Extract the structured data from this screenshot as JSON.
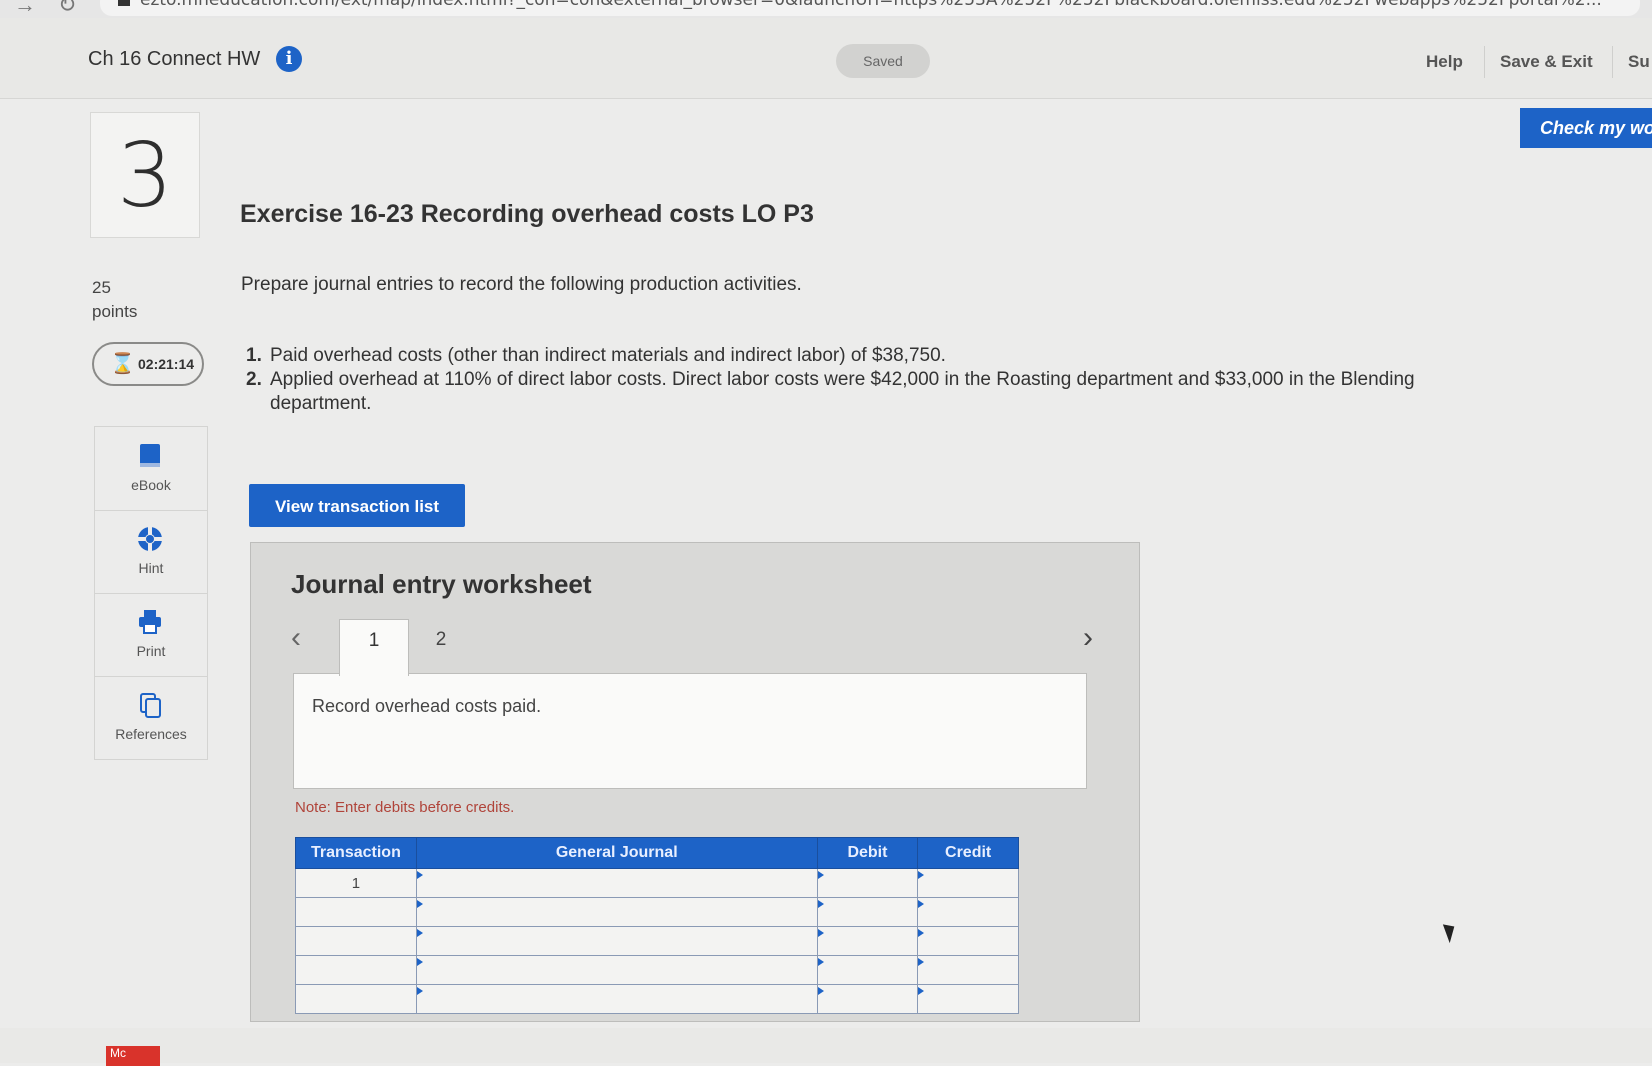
{
  "browser": {
    "url": "ezto.mheducation.com/ext/map/index.html?_con=con&external_browser=0&launchUrl=https%253A%252F%252Fblackboard.olemiss.edu%252Fwebapps%252Fportal%2..."
  },
  "header": {
    "assignment_title": "Ch 16 Connect HW",
    "info_icon": "i",
    "saved_label": "Saved",
    "help_label": "Help",
    "save_exit_label": "Save & Exit",
    "submit_label": "Su"
  },
  "question": {
    "number": "3",
    "points_value": "25",
    "points_label": "points",
    "timer": "02:21:14",
    "title": "Exercise 16-23 Recording overhead costs LO P3",
    "instruction": "Prepare journal entries to record the following production activities.",
    "tasks": [
      {
        "num": "1.",
        "text": "Paid overhead costs (other than indirect materials and indirect labor) of $38,750."
      },
      {
        "num": "2.",
        "text": "Applied overhead at 110% of direct labor costs. Direct labor costs were $42,000 in the Roasting department and $33,000 in the Blending department."
      }
    ]
  },
  "tools": {
    "ebook": "eBook",
    "hint": "Hint",
    "print": "Print",
    "references": "References"
  },
  "buttons": {
    "view_transaction_list": "View transaction list",
    "check_my_work": "Check my wo"
  },
  "worksheet": {
    "title": "Journal entry worksheet",
    "tabs": [
      "1",
      "2"
    ],
    "description": "Record overhead costs paid.",
    "note": "Note: Enter debits before credits.",
    "columns": [
      "Transaction",
      "General Journal",
      "Debit",
      "Credit"
    ],
    "rows": [
      {
        "transaction": "1",
        "account": "",
        "debit": "",
        "credit": ""
      },
      {
        "transaction": "",
        "account": "",
        "debit": "",
        "credit": ""
      },
      {
        "transaction": "",
        "account": "",
        "debit": "",
        "credit": ""
      },
      {
        "transaction": "",
        "account": "",
        "debit": "",
        "credit": ""
      },
      {
        "transaction": "",
        "account": "",
        "debit": "",
        "credit": ""
      }
    ]
  },
  "footer": {
    "logo_text": "Mc"
  },
  "colors": {
    "accent_blue": "#1d63c7",
    "note_red": "#b0443a"
  }
}
